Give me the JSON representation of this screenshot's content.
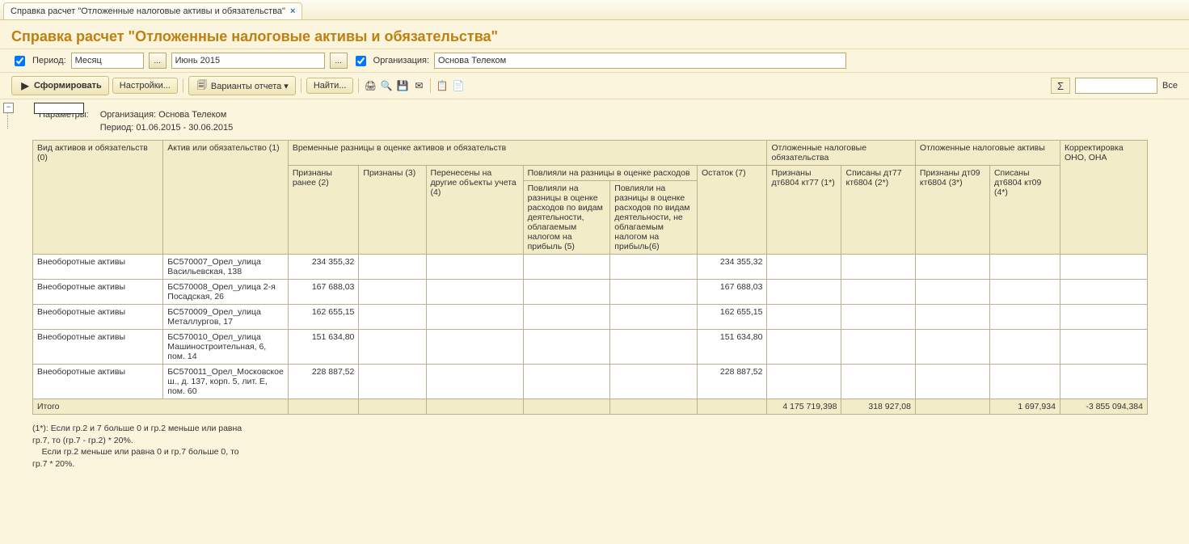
{
  "tab": {
    "title": "Справка расчет \"Отложенные налоговые активы и обязательства\"",
    "close": "×"
  },
  "page_title": "Справка расчет \"Отложенные налоговые активы и обязательства\"",
  "filters": {
    "period_label": "Период:",
    "period_type": "Месяц",
    "period_value": "Июнь 2015",
    "org_label": "Организация:",
    "org_value": "Основа Телеком",
    "dots": "..."
  },
  "toolbar": {
    "form": "Сформировать",
    "settings": "Настройки...",
    "variants": "Варианты отчета ▾",
    "find": "Найти...",
    "all": "Все"
  },
  "tree": {
    "minus": "−"
  },
  "params": {
    "label": "Параметры:",
    "org": "Организация: Основа Телеком",
    "period": "Период: 01.06.2015 - 30.06.2015"
  },
  "headers": {
    "c0": "Вид активов и обязательств (0)",
    "c1": "Актив или обязательство (1)",
    "g_temp": "Временные разницы в оценке активов и обязательств",
    "g_ono": "Отложенные налоговые обязательства",
    "g_ona": "Отложенные налоговые активы",
    "c_corr": "Корректировка ОНО, ОНА",
    "c2": "Признаны ранее (2)",
    "c3": "Признаны (3)",
    "c4": "Перенесены на другие объекты учета (4)",
    "g_infl": "Повлияли на разницы в оценке расходов",
    "c7": "Остаток (7)",
    "c5": "Повлияли на разницы в оценке расходов по видам деятельности, облагаемым налогом на прибыль (5)",
    "c6": "Повлияли на разницы в оценке расходов по видам деятельности, не облагаемым налогом на прибыль(6)",
    "c1s": "Признаны дт6804 кт77 (1*)",
    "c2s": "Списаны дт77 кт6804 (2*)",
    "c3s": "Признаны дт09 кт6804 (3*)",
    "c4s": "Списаны дт6804 кт09 (4*)"
  },
  "rows": [
    {
      "kind": "Внеоборотные активы",
      "asset": "БС570007_Орел_улица Васильевская, 138",
      "c2": "234 355,32",
      "c7": "234 355,32"
    },
    {
      "kind": "Внеоборотные активы",
      "asset": "БС570008_Орел_улица 2-я Посадская, 26",
      "c2": "167 688,03",
      "c7": "167 688,03"
    },
    {
      "kind": "Внеоборотные активы",
      "asset": "БС570009_Орел_улица Металлургов, 17",
      "c2": "162 655,15",
      "c7": "162 655,15"
    },
    {
      "kind": "Внеоборотные активы",
      "asset": "БС570010_Орел_улица Машиностроительная, 6, пом. 14",
      "c2": "151 634,80",
      "c7": "151 634,80"
    },
    {
      "kind": "Внеоборотные активы",
      "asset": "БС570011_Орел_Московское ш., д. 137, корп. 5, лит. Е, пом. 60",
      "c2": "228 887,52",
      "c7": "228 887,52"
    }
  ],
  "total": {
    "label": "Итого",
    "c1s": "4 175 719,398",
    "c2s": "318 927,08",
    "c4s": "1 697,934",
    "corr": "-3 855 094,384"
  },
  "footnotes": {
    "l1": "(1*): Если гр.2 и 7 больше 0 и гр.2 меньше или равна гр.7, то (гр.7 - гр.2) * 20%.",
    "l2": "    Если гр.2 меньше или равна 0 и гр.7 больше 0, то   гр.7 * 20%."
  }
}
